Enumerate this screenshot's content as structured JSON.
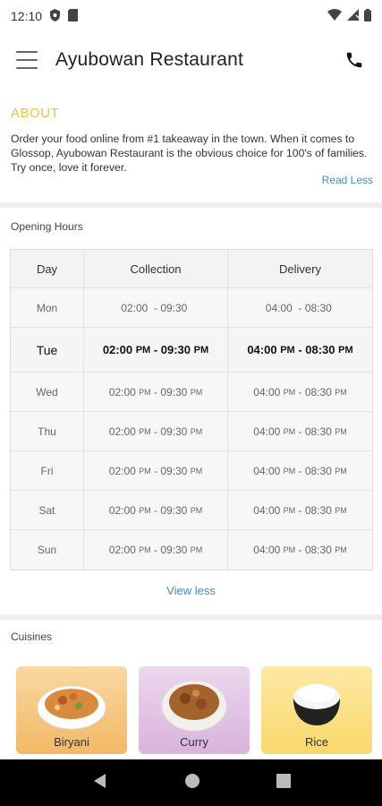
{
  "status_bar": {
    "time": "12:10"
  },
  "app_bar": {
    "title": "Ayubowan Restaurant"
  },
  "about": {
    "title": "ABOUT",
    "text": "Order your food online from #1 takeaway in the town. When it comes to Glossop, Ayubowan Restaurant is the obvious choice for 100's of families. Try once, love it forever.",
    "read_less": "Read Less"
  },
  "opening_hours": {
    "label": "Opening Hours",
    "headers": {
      "day": "Day",
      "collection": "Collection",
      "delivery": "Delivery"
    },
    "rows": [
      {
        "day": "Mon",
        "col_from": "02:00",
        "col_from_pm": "",
        "col_to": "- 09:30",
        "col_to_pm": "",
        "del_from": "04:00",
        "del_from_pm": "",
        "del_to": "- 08:30",
        "del_to_pm": ""
      },
      {
        "day": "Tue",
        "col_from": "02:00",
        "col_from_pm": "PM",
        "col_to": "- 09:30",
        "col_to_pm": "PM",
        "del_from": "04:00",
        "del_from_pm": "PM",
        "del_to": "- 08:30",
        "del_to_pm": "PM"
      },
      {
        "day": "Wed",
        "col_from": "02:00",
        "col_from_pm": "PM",
        "col_to": "- 09:30",
        "col_to_pm": "PM",
        "del_from": "04:00",
        "del_from_pm": "PM",
        "del_to": "- 08:30",
        "del_to_pm": "PM"
      },
      {
        "day": "Thu",
        "col_from": "02:00",
        "col_from_pm": "PM",
        "col_to": "- 09:30",
        "col_to_pm": "PM",
        "del_from": "04:00",
        "del_from_pm": "PM",
        "del_to": "- 08:30",
        "del_to_pm": "PM"
      },
      {
        "day": "Fri",
        "col_from": "02:00",
        "col_from_pm": "PM",
        "col_to": "- 09:30",
        "col_to_pm": "PM",
        "del_from": "04:00",
        "del_from_pm": "PM",
        "del_to": "- 08:30",
        "del_to_pm": "PM"
      },
      {
        "day": "Sat",
        "col_from": "02:00",
        "col_from_pm": "PM",
        "col_to": "- 09:30",
        "col_to_pm": "PM",
        "del_from": "04:00",
        "del_from_pm": "PM",
        "del_to": "- 08:30",
        "del_to_pm": "PM"
      },
      {
        "day": "Sun",
        "col_from": "02:00",
        "col_from_pm": "PM",
        "col_to": "- 09:30",
        "col_to_pm": "PM",
        "del_from": "04:00",
        "del_from_pm": "PM",
        "del_to": "- 08:30",
        "del_to_pm": "PM"
      }
    ],
    "view_less": "View less"
  },
  "cuisines": {
    "label": "Cuisines",
    "items": [
      {
        "label": "Biryani"
      },
      {
        "label": "Curry"
      },
      {
        "label": "Rice"
      }
    ]
  },
  "colors": {
    "accent": "#f0c040",
    "link": "#3a8fc6"
  },
  "icons": [
    "menu-icon",
    "phone-icon",
    "wifi-icon",
    "signal-icon",
    "battery-icon",
    "back-icon",
    "home-icon",
    "recents-icon"
  ]
}
